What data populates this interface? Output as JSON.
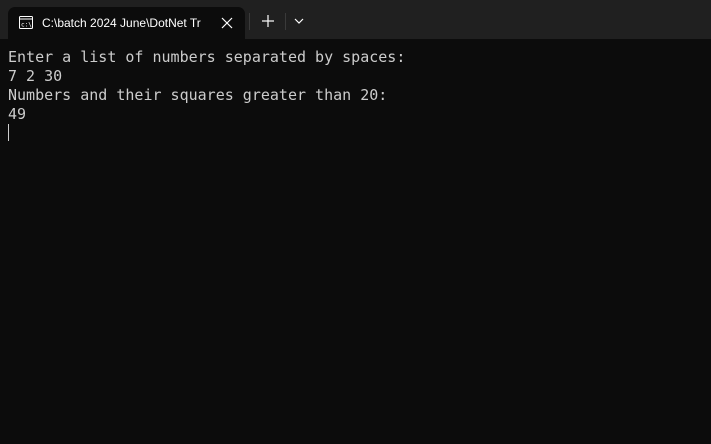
{
  "tab": {
    "title": "C:\\batch 2024 June\\DotNet Tr",
    "icon": "console-icon"
  },
  "tabbar": {
    "close_icon": "close-icon",
    "new_tab_icon": "plus-icon",
    "dropdown_icon": "chevron-down-icon"
  },
  "console": {
    "lines": [
      "Enter a list of numbers separated by spaces:",
      "7 2 30",
      "Numbers and their squares greater than 20:",
      "49"
    ]
  },
  "colors": {
    "background": "#0c0c0c",
    "tabbar": "#202020",
    "text": "#cccccc"
  }
}
